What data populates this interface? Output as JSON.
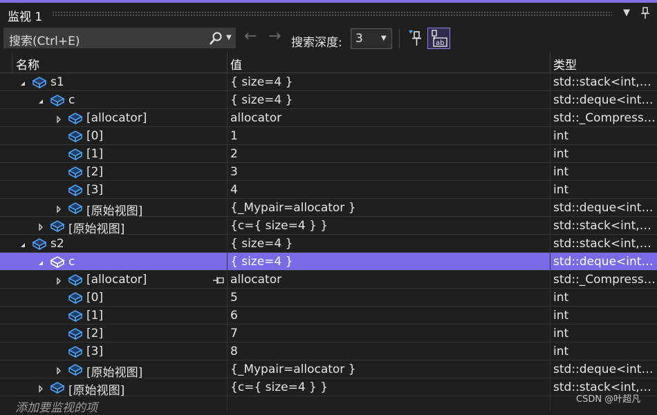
{
  "window": {
    "title": "监视 1"
  },
  "toolbar": {
    "search_placeholder": "搜索(Ctrl+E)",
    "depth_label": "搜索深度:",
    "depth_value": "3"
  },
  "columns": {
    "name": "名称",
    "value": "值",
    "type": "类型"
  },
  "rows": [
    {
      "indent": 0,
      "expander": "expanded",
      "name": "s1",
      "value": "{ size=4 }",
      "type": "std::stack<int,std::deque<int,std::allocator<int>>>"
    },
    {
      "indent": 1,
      "expander": "expanded",
      "name": "c",
      "value": "{ size=4 }",
      "type": "std::deque<int,std::allocator<int>>"
    },
    {
      "indent": 2,
      "expander": "collapsed",
      "name": "[allocator]",
      "value": "allocator",
      "type": "std::_Compressed_pair"
    },
    {
      "indent": 2,
      "expander": "none",
      "name": "[0]",
      "value": "1",
      "type": "int"
    },
    {
      "indent": 2,
      "expander": "none",
      "name": "[1]",
      "value": "2",
      "type": "int"
    },
    {
      "indent": 2,
      "expander": "none",
      "name": "[2]",
      "value": "3",
      "type": "int"
    },
    {
      "indent": 2,
      "expander": "none",
      "name": "[3]",
      "value": "4",
      "type": "int"
    },
    {
      "indent": 2,
      "expander": "collapsed",
      "name": "[原始视图]",
      "value": "{_Mypair=allocator }",
      "type": "std::deque<int,std::allocator<int>>"
    },
    {
      "indent": 1,
      "expander": "collapsed",
      "name": "[原始视图]",
      "value": "{c={ size=4 } }",
      "type": "std::stack<int,std::deque<int,std::allocator<int>>>"
    },
    {
      "indent": 0,
      "expander": "expanded",
      "name": "s2",
      "value": "{ size=4 }",
      "type": "std::stack<int,std::deque<int,std::allocator<int>>>"
    },
    {
      "indent": 1,
      "expander": "expanded",
      "name": "c",
      "value": "{ size=4 }",
      "type": "std::deque<int,std::allocator<int>>",
      "selected": true
    },
    {
      "indent": 2,
      "expander": "collapsed",
      "name": "[allocator]",
      "value": "allocator",
      "type": "std::_Compressed_pair",
      "pinned": true
    },
    {
      "indent": 2,
      "expander": "none",
      "name": "[0]",
      "value": "5",
      "type": "int"
    },
    {
      "indent": 2,
      "expander": "none",
      "name": "[1]",
      "value": "6",
      "type": "int"
    },
    {
      "indent": 2,
      "expander": "none",
      "name": "[2]",
      "value": "7",
      "type": "int"
    },
    {
      "indent": 2,
      "expander": "none",
      "name": "[3]",
      "value": "8",
      "type": "int"
    },
    {
      "indent": 2,
      "expander": "collapsed",
      "name": "[原始视图]",
      "value": "{_Mypair=allocator }",
      "type": "std::deque<int,std::allocator<int>>"
    },
    {
      "indent": 1,
      "expander": "collapsed",
      "name": "[原始视图]",
      "value": "{c={ size=4 } }",
      "type": "std::stack<int,std::deque<int,std::allocator<int>>>"
    }
  ],
  "add_item_placeholder": "添加要监视的项",
  "watermark": "CSDN @叶超凡",
  "colors": {
    "accent": "#8170e6",
    "selection": "#7b6ae6",
    "icon_blue": "#4aa3ff"
  },
  "icons": {
    "menu": "chevron-down-icon",
    "pin": "pin-icon",
    "search": "search-icon",
    "back": "arrow-left-icon",
    "forward": "arrow-right-icon",
    "pin_watch": "pin-watch-icon",
    "hex": "hex-display-icon",
    "object": "cube-icon"
  }
}
